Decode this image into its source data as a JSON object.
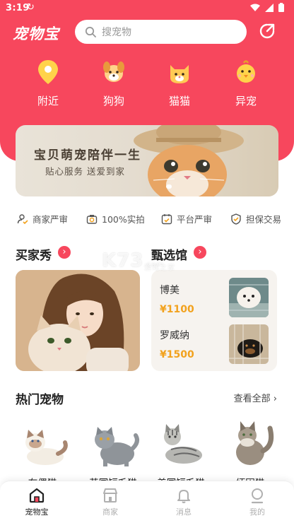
{
  "status": {
    "time": "3:19",
    "sync": "↻"
  },
  "header": {
    "logo": "宠物宝",
    "search_placeholder": "搜宠物",
    "share_icon": "share-icon"
  },
  "categories": [
    {
      "label": "附近",
      "icon": "location-pin-icon"
    },
    {
      "label": "狗狗",
      "icon": "dog-icon"
    },
    {
      "label": "猫猫",
      "icon": "cat-icon"
    },
    {
      "label": "异宠",
      "icon": "chick-icon"
    }
  ],
  "banner": {
    "title": "宝贝萌宠陪伴一生",
    "subtitle": "贴心服务 送爱到家"
  },
  "features": [
    {
      "label": "商家严审",
      "icon": "merchant-check-icon"
    },
    {
      "label": "100%实拍",
      "icon": "camera-icon"
    },
    {
      "label": "平台严审",
      "icon": "calendar-check-icon"
    },
    {
      "label": "担保交易",
      "icon": "shield-check-icon"
    }
  ],
  "buyer_show": {
    "title": "买家秀"
  },
  "selection": {
    "title": "甄选馆",
    "items": [
      {
        "name": "博美",
        "price": "¥1100"
      },
      {
        "name": "罗威纳",
        "price": "¥1500"
      }
    ]
  },
  "hot": {
    "title": "热门宠物",
    "see_all": "查看全部 ›",
    "pets": [
      {
        "name": "布偶猫"
      },
      {
        "name": "英国短毛猫"
      },
      {
        "name": "美国短毛猫"
      },
      {
        "name": "缅因猫"
      }
    ]
  },
  "watermark": {
    "text": "K73",
    "sub": "游戏之家",
    "domain": ".com"
  },
  "nav": [
    {
      "label": "宠物宝",
      "icon": "home-icon",
      "active": true
    },
    {
      "label": "商家",
      "icon": "store-icon",
      "active": false
    },
    {
      "label": "消息",
      "icon": "bell-icon",
      "active": false
    },
    {
      "label": "我的",
      "icon": "profile-icon",
      "active": false
    }
  ],
  "colors": {
    "brand": "#f7475d",
    "price": "#f2a21e"
  }
}
